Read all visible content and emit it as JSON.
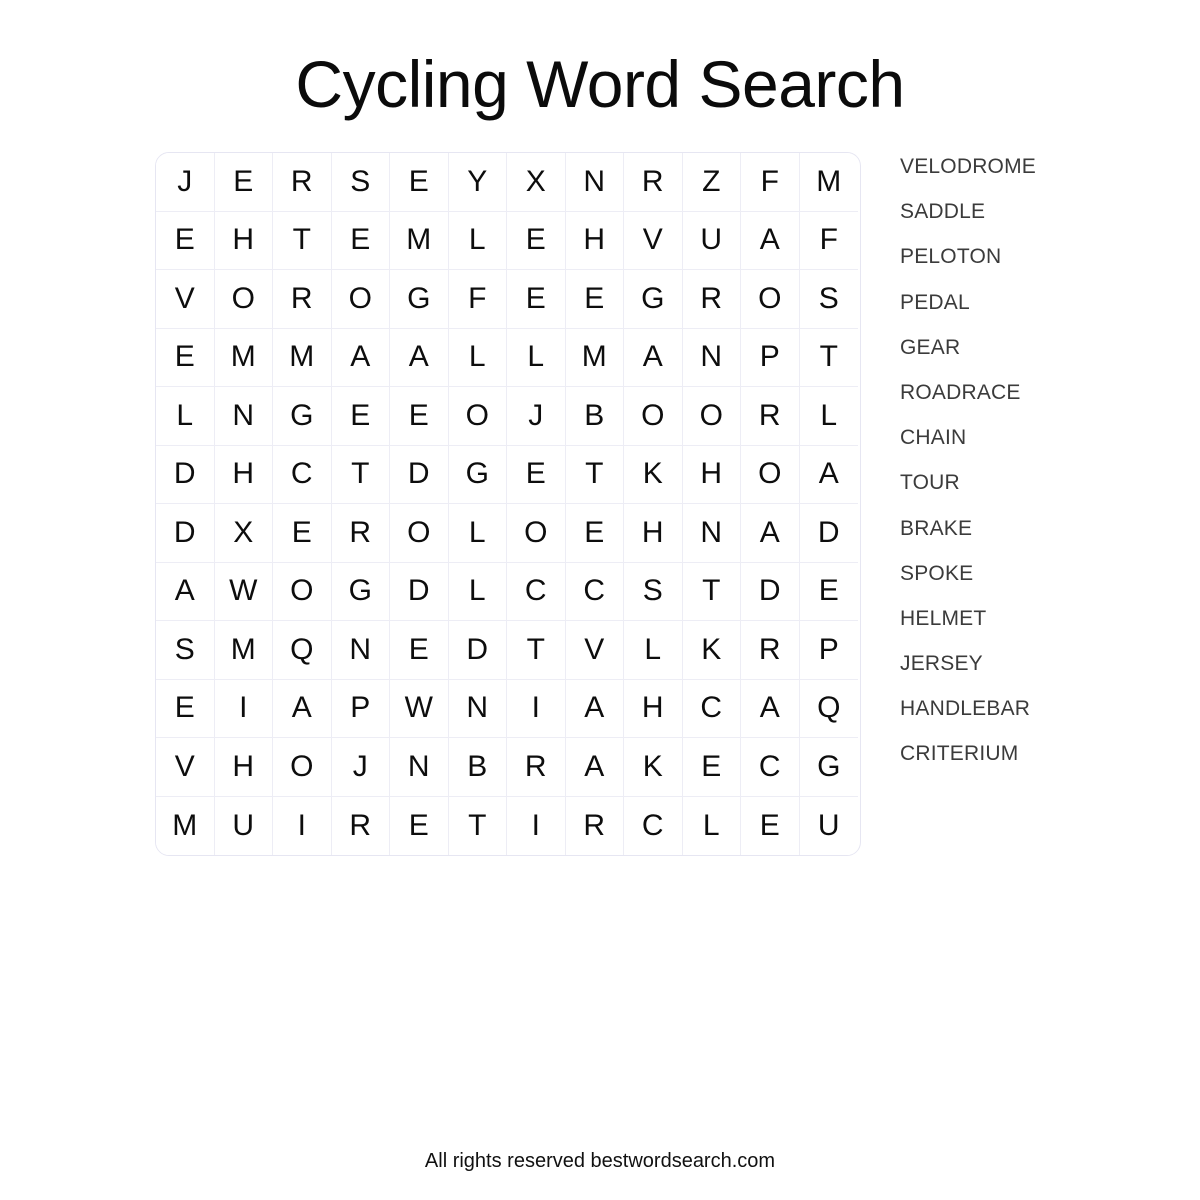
{
  "title": "Cycling Word Search",
  "footer": "All rights reserved bestwordsearch.com",
  "colors": {
    "page_background": "#ffffff",
    "title_text": "#0b0b0b",
    "grid_letter": "#0d0d0d",
    "grid_border": "#e6e6f2",
    "grid_cell_divider": "#ededf5",
    "word_list_text": "#3b3b3b",
    "footer_text": "#111111"
  },
  "grid": {
    "rows": 12,
    "columns": 12,
    "letters": [
      [
        "J",
        "E",
        "R",
        "S",
        "E",
        "Y",
        "X",
        "N",
        "R",
        "Z",
        "F",
        "M"
      ],
      [
        "E",
        "H",
        "T",
        "E",
        "M",
        "L",
        "E",
        "H",
        "V",
        "U",
        "A",
        "F"
      ],
      [
        "V",
        "O",
        "R",
        "O",
        "G",
        "F",
        "E",
        "E",
        "G",
        "R",
        "O",
        "S"
      ],
      [
        "E",
        "M",
        "M",
        "A",
        "A",
        "L",
        "L",
        "M",
        "A",
        "N",
        "P",
        "T"
      ],
      [
        "L",
        "N",
        "G",
        "E",
        "E",
        "O",
        "J",
        "B",
        "O",
        "O",
        "R",
        "L"
      ],
      [
        "D",
        "H",
        "C",
        "T",
        "D",
        "G",
        "E",
        "T",
        "K",
        "H",
        "O",
        "A"
      ],
      [
        "D",
        "X",
        "E",
        "R",
        "O",
        "L",
        "O",
        "E",
        "H",
        "N",
        "A",
        "D"
      ],
      [
        "A",
        "W",
        "O",
        "G",
        "D",
        "L",
        "C",
        "C",
        "S",
        "T",
        "D",
        "E"
      ],
      [
        "S",
        "M",
        "Q",
        "N",
        "E",
        "D",
        "T",
        "V",
        "L",
        "K",
        "R",
        "P"
      ],
      [
        "E",
        "I",
        "A",
        "P",
        "W",
        "N",
        "I",
        "A",
        "H",
        "C",
        "A",
        "Q"
      ],
      [
        "V",
        "H",
        "O",
        "J",
        "N",
        "B",
        "R",
        "A",
        "K",
        "E",
        "C",
        "G"
      ],
      [
        "M",
        "U",
        "I",
        "R",
        "E",
        "T",
        "I",
        "R",
        "C",
        "L",
        "E",
        "U"
      ]
    ]
  },
  "word_list": [
    "VELODROME",
    "SADDLE",
    "PELOTON",
    "PEDAL",
    "GEAR",
    "ROADRACE",
    "CHAIN",
    "TOUR",
    "BRAKE",
    "SPOKE",
    "HELMET",
    "JERSEY",
    "HANDLEBAR",
    "CRITERIUM"
  ]
}
